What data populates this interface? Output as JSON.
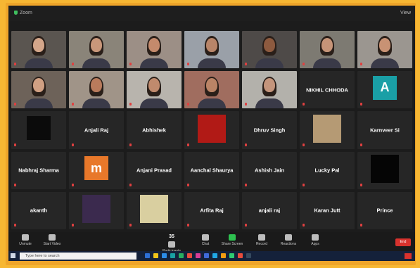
{
  "window": {
    "title": "Zoom",
    "view_label": "View"
  },
  "tiles": [
    {
      "kind": "video",
      "caption": "",
      "skin": "#d4a68a",
      "bg": "#5a5550"
    },
    {
      "kind": "video",
      "caption": "",
      "skin": "#c9977a",
      "bg": "#8a8479"
    },
    {
      "kind": "video",
      "caption": "",
      "skin": "#c48a6c",
      "bg": "#9c8f86"
    },
    {
      "kind": "video",
      "caption": "",
      "skin": "#b88569",
      "bg": "#9aa0a8"
    },
    {
      "kind": "video",
      "caption": "",
      "skin": "#8d5a3f",
      "bg": "#4e4a48"
    },
    {
      "kind": "video",
      "caption": "",
      "skin": "#c69478",
      "bg": "#7d7a72"
    },
    {
      "kind": "video",
      "caption": "",
      "skin": "#c89274",
      "bg": "#9b9690"
    },
    {
      "kind": "video",
      "caption": "",
      "skin": "#d1a083",
      "bg": "#6d6259"
    },
    {
      "kind": "video",
      "caption": "",
      "skin": "#b97b5c",
      "bg": "#a09488"
    },
    {
      "kind": "video",
      "caption": "",
      "skin": "#c08a6d",
      "bg": "#b8b4ad"
    },
    {
      "kind": "video",
      "caption": "",
      "skin": "#ba8466",
      "bg": "#a06d5f"
    },
    {
      "kind": "video",
      "caption": "",
      "skin": "#c4957c",
      "bg": "#b3b1ab"
    },
    {
      "kind": "name",
      "name": "NIKHIL CHHODA",
      "caption": ""
    },
    {
      "kind": "avatar",
      "letter": "A",
      "color": "#1a9fa6",
      "caption": ""
    },
    {
      "kind": "logo",
      "caption": ""
    },
    {
      "kind": "name",
      "name": "Anjali Raj",
      "caption": ""
    },
    {
      "kind": "name",
      "name": "Abhishek",
      "caption": ""
    },
    {
      "kind": "image",
      "color": "#b11a16",
      "caption": ""
    },
    {
      "kind": "name",
      "name": "Dhruv Singh",
      "caption": ""
    },
    {
      "kind": "image",
      "color": "#b59a74",
      "caption": ""
    },
    {
      "kind": "name",
      "name": "Karnveer Si",
      "caption": ""
    },
    {
      "kind": "name",
      "name": "Nabhraj Sharma",
      "caption": ""
    },
    {
      "kind": "avatar",
      "letter": "m",
      "color": "#e8782a",
      "caption": ""
    },
    {
      "kind": "name",
      "name": "Anjani Prasad",
      "caption": ""
    },
    {
      "kind": "name",
      "name": "Aanchal Shaurya",
      "caption": ""
    },
    {
      "kind": "name",
      "name": "Ashish Jain",
      "caption": ""
    },
    {
      "kind": "name",
      "name": "Lucky Pal",
      "caption": ""
    },
    {
      "kind": "image",
      "color": "#050505",
      "caption": ""
    },
    {
      "kind": "name",
      "name": "akanth",
      "caption": ""
    },
    {
      "kind": "image",
      "color": "#3b2a4e",
      "caption": ""
    },
    {
      "kind": "image",
      "color": "#d9cfa0",
      "caption": ""
    },
    {
      "kind": "name",
      "name": "Arfita Raj",
      "caption": ""
    },
    {
      "kind": "name",
      "name": "anjali raj",
      "caption": ""
    },
    {
      "kind": "name",
      "name": "Karan Jutt",
      "caption": ""
    },
    {
      "kind": "name",
      "name": "Prince",
      "caption": ""
    }
  ],
  "toolbar": {
    "buttons": [
      {
        "label": "Unmute",
        "icon": "microphone-icon",
        "green": false,
        "badge": ""
      },
      {
        "label": "Start Video",
        "icon": "video-camera-icon",
        "green": false,
        "badge": ""
      },
      {
        "label": "Participants",
        "icon": "participants-icon",
        "green": false,
        "badge": "35"
      },
      {
        "label": "Chat",
        "icon": "chat-icon",
        "green": false,
        "badge": ""
      },
      {
        "label": "Share Screen",
        "icon": "share-screen-icon",
        "green": true,
        "badge": ""
      },
      {
        "label": "Record",
        "icon": "record-icon",
        "green": false,
        "badge": ""
      },
      {
        "label": "Reactions",
        "icon": "reactions-icon",
        "green": false,
        "badge": ""
      },
      {
        "label": "Apps",
        "icon": "apps-icon",
        "green": false,
        "badge": ""
      }
    ],
    "end_label": "End"
  },
  "taskbar": {
    "search_placeholder": "Type here to search",
    "apps": [
      "#2d6fd6",
      "#f0c419",
      "#2c8ce8",
      "#19a1a3",
      "#27ae60",
      "#e84b3c",
      "#d63d97",
      "#3f6ad8",
      "#20a8e8",
      "#f39c12",
      "#2ecc71",
      "#e74c3c",
      "#34495e"
    ]
  }
}
